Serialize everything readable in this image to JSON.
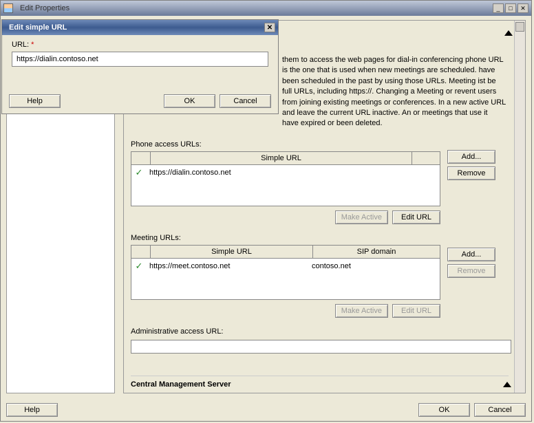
{
  "main_window": {
    "title": "Edit Properties"
  },
  "description": "them to access the web pages for dial-in conferencing phone URL is the one that is used when new meetings are scheduled. have been scheduled in the past by using those URLs. Meeting ist be full URLs, including https://. Changing a Meeting or revent users from joining existing meetings or conferences. In a new active URL and leave the current URL inactive. An or meetings that use it have expired or been deleted.",
  "phone_section": {
    "label": "Phone access URLs:",
    "header": "Simple URL",
    "rows": [
      {
        "url": "https://dialin.contoso.net"
      }
    ],
    "add_btn": "Add...",
    "remove_btn": "Remove",
    "make_active_btn": "Make Active",
    "edit_url_btn": "Edit URL"
  },
  "meeting_section": {
    "label": "Meeting URLs:",
    "header_url": "Simple URL",
    "header_sip": "SIP domain",
    "rows": [
      {
        "url": "https://meet.contoso.net",
        "sip": "contoso.net"
      }
    ],
    "add_btn": "Add...",
    "remove_btn": "Remove",
    "make_active_btn": "Make Active",
    "edit_url_btn": "Edit URL"
  },
  "admin_section": {
    "label": "Administrative access URL:",
    "value": ""
  },
  "cms_header": "Central Management Server",
  "footer": {
    "help": "Help",
    "ok": "OK",
    "cancel": "Cancel"
  },
  "modal": {
    "title": "Edit simple URL",
    "url_label": "URL:",
    "url_value": "https://dialin.contoso.net",
    "help": "Help",
    "ok": "OK",
    "cancel": "Cancel"
  }
}
